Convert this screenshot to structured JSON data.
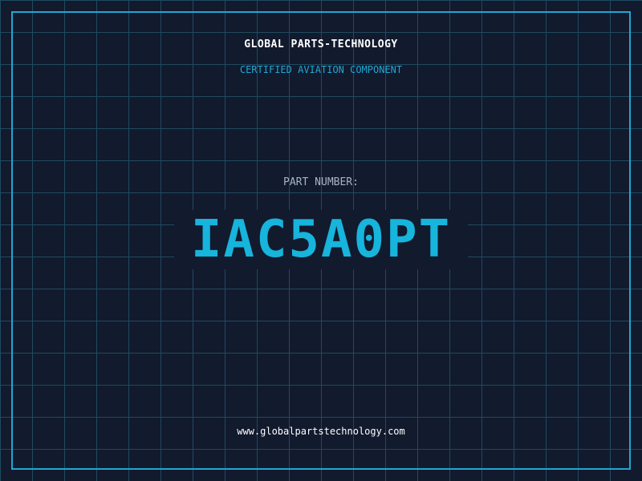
{
  "header": {
    "company": "GLOBAL PARTS-TECHNOLOGY",
    "subtitle": "CERTIFIED AVIATION COMPONENT"
  },
  "part": {
    "label": "PART NUMBER:",
    "number": "IAC5A0PT"
  },
  "footer": {
    "url": "www.globalpartstechnology.com"
  },
  "colors": {
    "background": "#121a2e",
    "grid": "#1f4a5f",
    "accent": "#22a6d2",
    "part_number": "#17b4dc",
    "label": "#a7b4c4",
    "text": "#ffffff"
  }
}
